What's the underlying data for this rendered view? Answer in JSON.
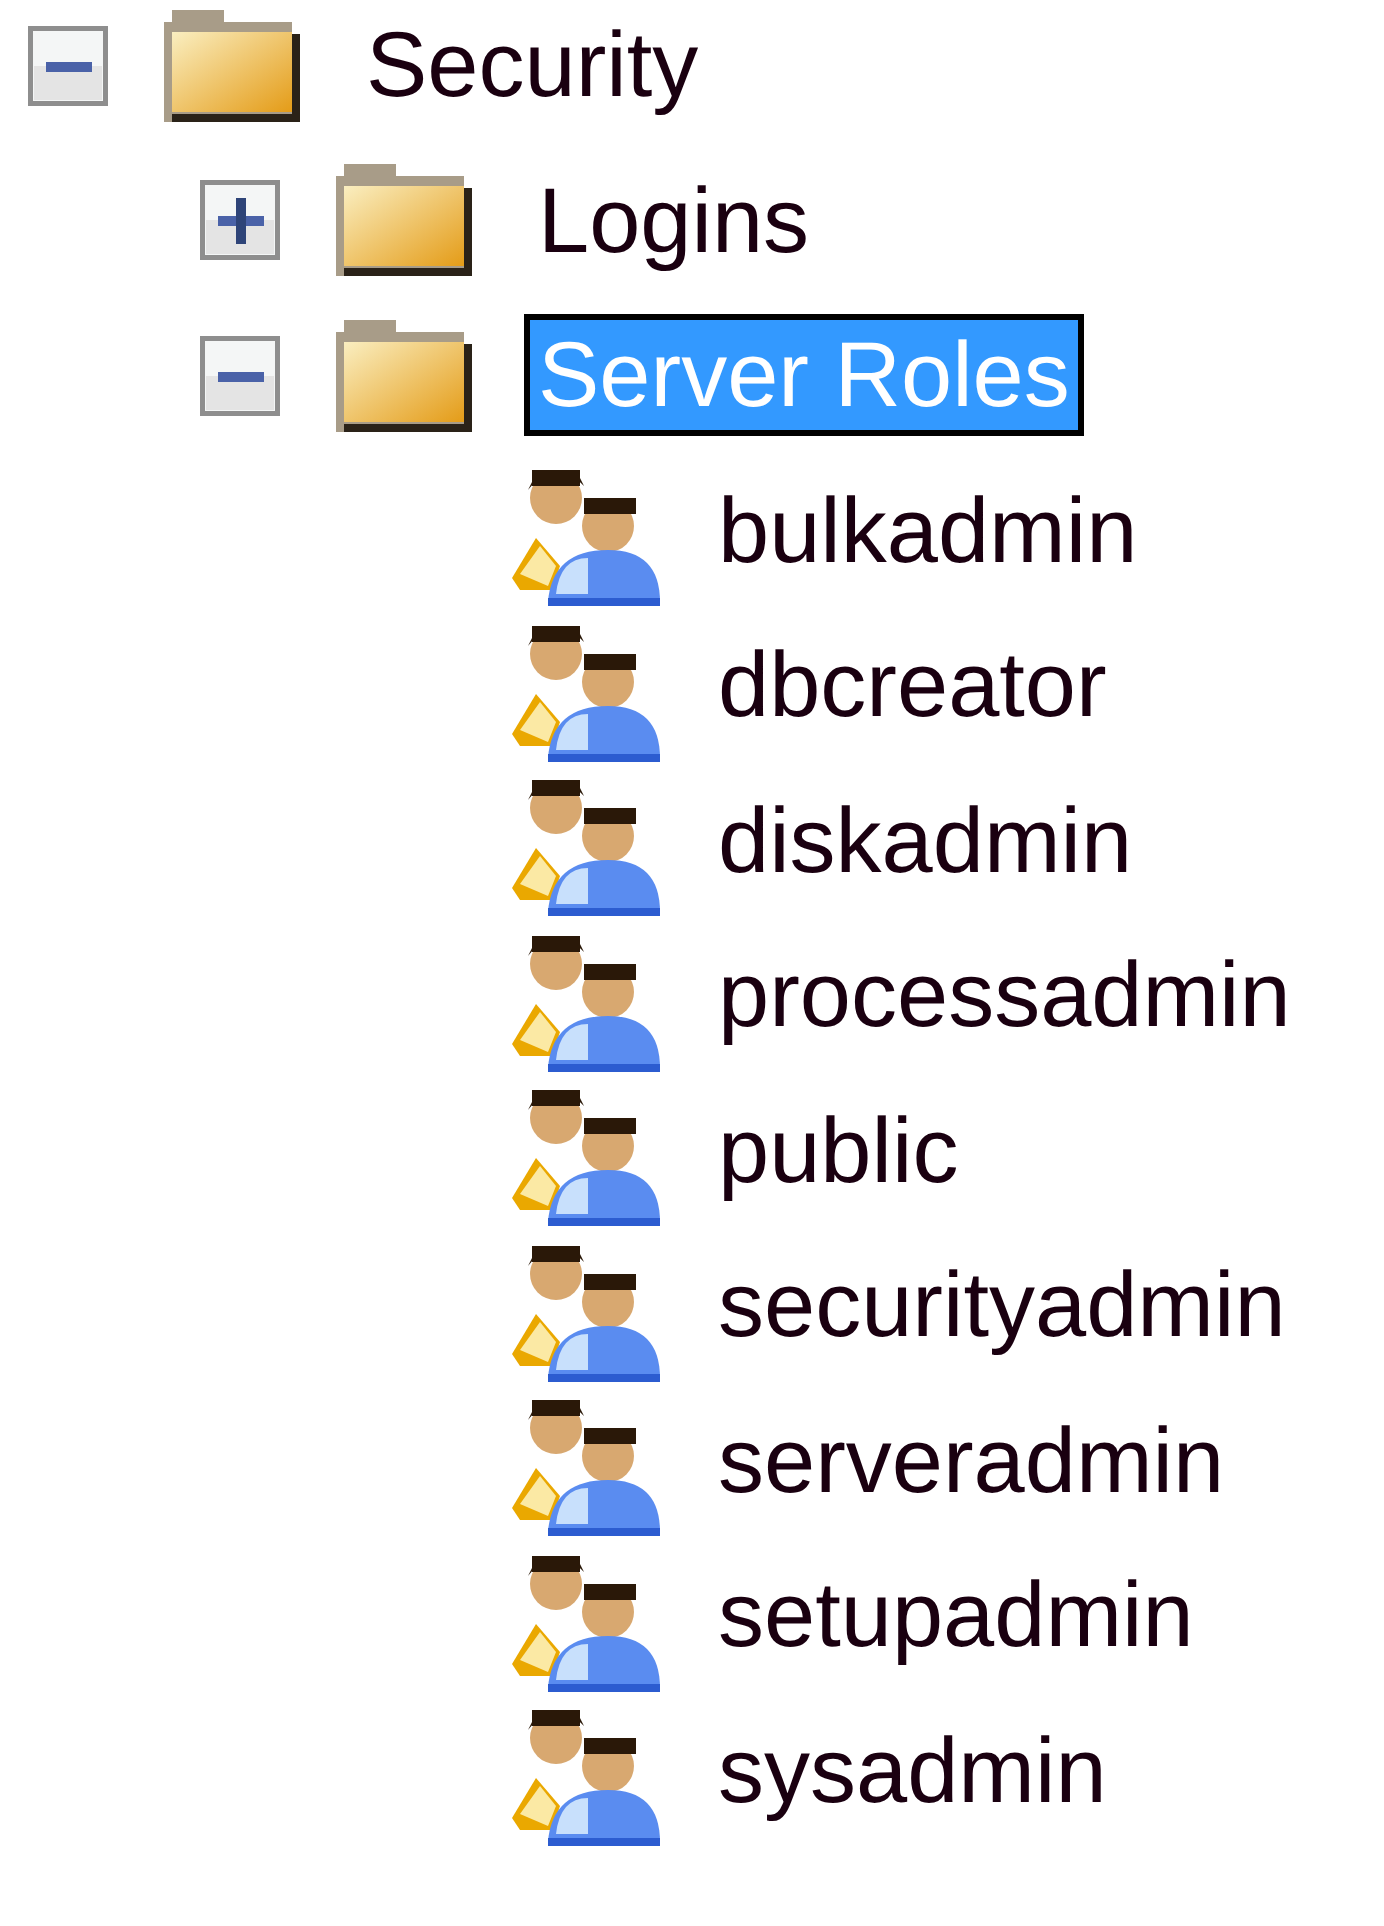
{
  "tree": [
    {
      "label": "Security",
      "kind": "folder",
      "expanded": true,
      "selected": false,
      "children": [
        {
          "label": "Logins",
          "kind": "folder",
          "expanded": false,
          "selected": false
        },
        {
          "label": "Server Roles",
          "kind": "folder",
          "expanded": true,
          "selected": true,
          "children": [
            {
              "label": "bulkadmin",
              "kind": "role",
              "selected": false
            },
            {
              "label": "dbcreator",
              "kind": "role",
              "selected": false
            },
            {
              "label": "diskadmin",
              "kind": "role",
              "selected": false
            },
            {
              "label": "processadmin",
              "kind": "role",
              "selected": false
            },
            {
              "label": "public",
              "kind": "role",
              "selected": false
            },
            {
              "label": "securityadmin",
              "kind": "role",
              "selected": false
            },
            {
              "label": "serveradmin",
              "kind": "role",
              "selected": false
            },
            {
              "label": "setupadmin",
              "kind": "role",
              "selected": false
            },
            {
              "label": "sysadmin",
              "kind": "role",
              "selected": false
            }
          ]
        }
      ]
    }
  ]
}
